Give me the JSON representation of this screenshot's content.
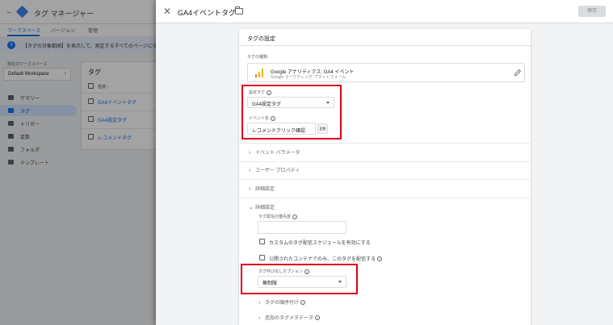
{
  "background_app": {
    "app_name": "タグ マネージャー",
    "tabs": [
      "ワークスペース",
      "バージョン",
      "管理"
    ],
    "info_banner": "【タグの対象範囲】を表示して、測定するすべてのページにタグ マ",
    "workspace_label": "現在のワークスペース",
    "workspace_name": "Default Workspace",
    "nav": [
      "サマリー",
      "タグ",
      "トリガー",
      "変数",
      "フォルダ",
      "テンプレート"
    ],
    "tags_card": {
      "title": "タグ",
      "column_header": "名前 ↑",
      "rows": [
        "GA4イベントタグ",
        "GA4設定タグ",
        "レコメンドタグ"
      ]
    }
  },
  "panel": {
    "title": "GA4イベントタグ",
    "save_label": "保存",
    "card_title": "タグの設定",
    "tag_type_label": "タグの種類",
    "tag_type_name": "Google アナリティクス: GA4 イベント",
    "tag_type_sub": "Google マーケティング プラットフォーム",
    "config_tag_label": "設定タグ",
    "config_tag_value": "GA4設定タグ",
    "event_name_label": "イベント名",
    "event_name_value": "レコメンドクリック確認",
    "var_button": "変数",
    "sections": [
      "イベント パラメータ",
      "ユーザー プロパティ",
      "詳細設定"
    ],
    "advanced_open_label": "詳細設定",
    "priority_label": "タグ配信の優先度",
    "custom_schedule_label": "カスタムのタグ配信スケジュールを有効にする",
    "published_only_label": "公開されたコンテナでのみ、このタグを配信する",
    "firing_option_label": "タグ呼び出しオプション",
    "firing_option_value": "無制限",
    "tag_sequencing_label": "タグの順序付け",
    "metadata_label": "追加のタグメタデータ"
  },
  "colors": {
    "accent": "#1a73e8",
    "highlight_frame": "#e0001a",
    "ga_orange": "#f9ab00",
    "ga_dark_orange": "#e37400"
  }
}
